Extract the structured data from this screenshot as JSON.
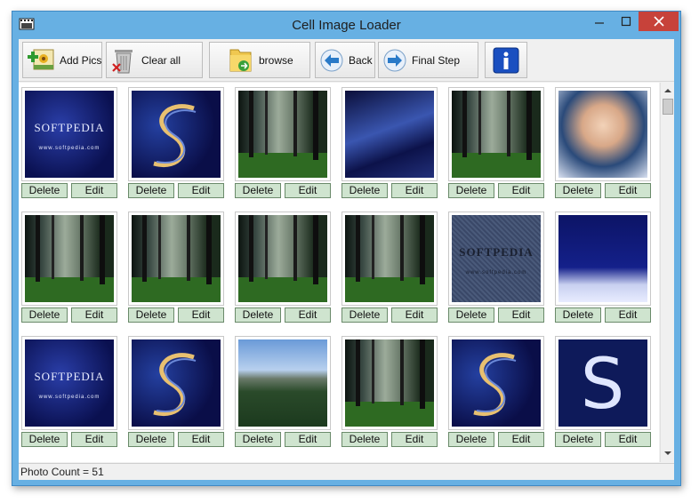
{
  "window": {
    "title": "Cell Image Loader",
    "icon": "film-app-icon"
  },
  "toolbar": {
    "buttons": [
      {
        "label": "Add Pics",
        "icon": "add-pictures-icon"
      },
      {
        "label": "Clear all",
        "icon": "trash-icon"
      },
      {
        "label": "browse",
        "icon": "folder-icon"
      },
      {
        "label": "Back",
        "icon": "back-arrow-icon"
      },
      {
        "label": "Final Step",
        "icon": "forward-arrow-icon"
      },
      {
        "label": "",
        "icon": "info-icon"
      }
    ]
  },
  "grid": {
    "delete_label": "Delete",
    "edit_label": "Edit",
    "images": [
      {
        "caption": "SOFTPEDIA",
        "sub": "www.softpedia.com",
        "kind": "logo-blue"
      },
      {
        "caption": "",
        "sub": "",
        "kind": "s-swirl"
      },
      {
        "caption": "",
        "sub": "",
        "kind": "forest"
      },
      {
        "caption": "",
        "sub": "",
        "kind": "abstract-blue"
      },
      {
        "caption": "",
        "sub": "",
        "kind": "forest"
      },
      {
        "caption": "",
        "sub": "",
        "kind": "portrait"
      },
      {
        "caption": "",
        "sub": "",
        "kind": "forest"
      },
      {
        "caption": "",
        "sub": "",
        "kind": "forest"
      },
      {
        "caption": "",
        "sub": "",
        "kind": "forest"
      },
      {
        "caption": "",
        "sub": "",
        "kind": "forest"
      },
      {
        "caption": "SOFTPEDIA",
        "sub": "www.softpedia.com",
        "kind": "fabric"
      },
      {
        "caption": "",
        "sub": "",
        "kind": "portrait-blue"
      },
      {
        "caption": "SOFTPEDIA",
        "sub": "www.softpedia.com",
        "kind": "logo-blue"
      },
      {
        "caption": "",
        "sub": "",
        "kind": "s-swirl"
      },
      {
        "caption": "",
        "sub": "",
        "kind": "mountain"
      },
      {
        "caption": "",
        "sub": "",
        "kind": "forest"
      },
      {
        "caption": "",
        "sub": "",
        "kind": "s-swirl"
      },
      {
        "caption": "S",
        "sub": "",
        "kind": "big-s"
      }
    ]
  },
  "status": {
    "text": "Photo Count = 51"
  }
}
